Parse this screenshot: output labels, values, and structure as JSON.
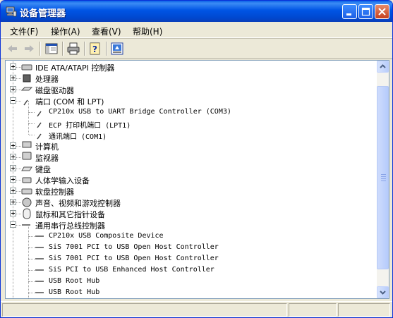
{
  "window": {
    "title": "设备管理器"
  },
  "menu": [
    {
      "label": "文件(F)"
    },
    {
      "label": "操作(A)"
    },
    {
      "label": "查看(V)"
    },
    {
      "label": "帮助(H)"
    }
  ],
  "tree": [
    {
      "label": "IDE ATA/ATAPI 控制器",
      "level": 0,
      "expander": "plus",
      "icon": "ide-controller-icon"
    },
    {
      "label": "处理器",
      "level": 0,
      "expander": "plus",
      "icon": "processor-icon"
    },
    {
      "label": "磁盘驱动器",
      "level": 0,
      "expander": "plus",
      "icon": "disk-drive-icon"
    },
    {
      "label": "端口 (COM 和 LPT)",
      "level": 0,
      "expander": "minus",
      "icon": "port-icon"
    },
    {
      "label": "CP210x USB to UART Bridge Controller (COM3)",
      "level": 1,
      "icon": "port-icon"
    },
    {
      "label": "ECP 打印机端口 (LPT1)",
      "level": 1,
      "icon": "port-icon"
    },
    {
      "label": "通讯端口 (COM1)",
      "level": 1,
      "icon": "port-icon"
    },
    {
      "label": "计算机",
      "level": 0,
      "expander": "plus",
      "icon": "computer-icon"
    },
    {
      "label": "监视器",
      "level": 0,
      "expander": "plus",
      "icon": "monitor-icon"
    },
    {
      "label": "键盘",
      "level": 0,
      "expander": "plus",
      "icon": "keyboard-icon"
    },
    {
      "label": "人体学输入设备",
      "level": 0,
      "expander": "plus",
      "icon": "hid-icon"
    },
    {
      "label": "软盘控制器",
      "level": 0,
      "expander": "plus",
      "icon": "floppy-controller-icon"
    },
    {
      "label": "声音、视频和游戏控制器",
      "level": 0,
      "expander": "plus",
      "icon": "sound-icon"
    },
    {
      "label": "鼠标和其它指针设备",
      "level": 0,
      "expander": "plus",
      "icon": "mouse-icon"
    },
    {
      "label": "通用串行总线控制器",
      "level": 0,
      "expander": "minus",
      "icon": "usb-icon"
    },
    {
      "label": "CP210x USB Composite Device",
      "level": 1,
      "icon": "usb-icon"
    },
    {
      "label": "SiS 7001 PCI to USB Open Host Controller",
      "level": 1,
      "icon": "usb-icon"
    },
    {
      "label": "SiS 7001 PCI to USB Open Host Controller",
      "level": 1,
      "icon": "usb-icon"
    },
    {
      "label": "SiS PCI to USB Enhanced Host Controller",
      "level": 1,
      "icon": "usb-icon"
    },
    {
      "label": "USB Root Hub",
      "level": 1,
      "icon": "usb-icon"
    },
    {
      "label": "USB Root Hub",
      "level": 1,
      "icon": "usb-icon"
    },
    {
      "label": "",
      "level": 1,
      "icon": "usb-icon"
    }
  ]
}
